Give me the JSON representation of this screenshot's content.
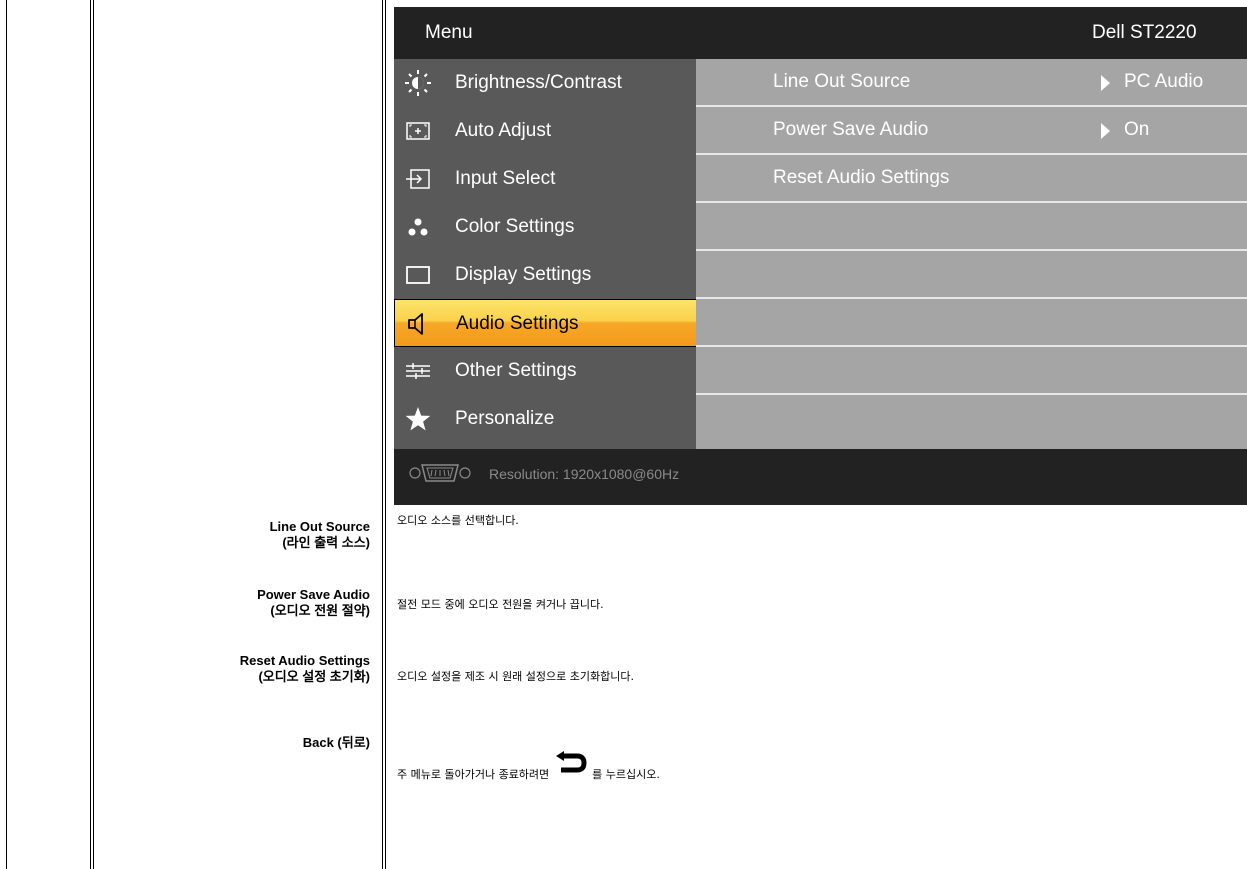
{
  "osd": {
    "title": "Menu",
    "model": "Dell ST2220",
    "menu_items": [
      {
        "label": "Brightness/Contrast",
        "icon": "brightness-icon"
      },
      {
        "label": "Auto Adjust",
        "icon": "auto-adjust-icon"
      },
      {
        "label": "Input Select",
        "icon": "input-select-icon"
      },
      {
        "label": "Color Settings",
        "icon": "color-settings-icon"
      },
      {
        "label": "Display Settings",
        "icon": "display-settings-icon"
      },
      {
        "label": "Audio Settings",
        "icon": "speaker-icon",
        "active": true
      },
      {
        "label": "Other Settings",
        "icon": "sliders-icon"
      },
      {
        "label": "Personalize",
        "icon": "star-icon"
      }
    ],
    "sub_items": [
      {
        "label": "Line Out Source",
        "value": "PC Audio"
      },
      {
        "label": "Power Save Audio",
        "value": "On"
      },
      {
        "label": "Reset Audio Settings",
        "value": ""
      }
    ],
    "resolution": "Resolution:  1920x1080@60Hz",
    "colors": {
      "menu_bg": "#595959",
      "sub_bg": "#a5a5a5",
      "frame": "#222222",
      "active": "#f6a828"
    }
  },
  "rows": [
    {
      "label_line1": "Line Out Source",
      "label_line2": "(라인 출력 소스)",
      "desc": "오디오 소스를 선택합니다."
    },
    {
      "label_line1": "Power Save Audio",
      "label_line2": "(오디오 전원 절약)",
      "desc": "절전 모드 중에 오디오 전원을 켜거나 끕니다."
    },
    {
      "label_line1": "Reset Audio Settings",
      "label_line2": "(오디오 설정 초기화)",
      "desc": "오디오 설정을 제조 시 원래 설정으로 초기화합니다."
    },
    {
      "label_line1": "Back (뒤로)",
      "label_line2": "",
      "desc_before": "주 메뉴로 돌아가거나 종료하려면",
      "desc_after": "를 누르십시오.",
      "icon": "back-arrow-icon"
    }
  ]
}
